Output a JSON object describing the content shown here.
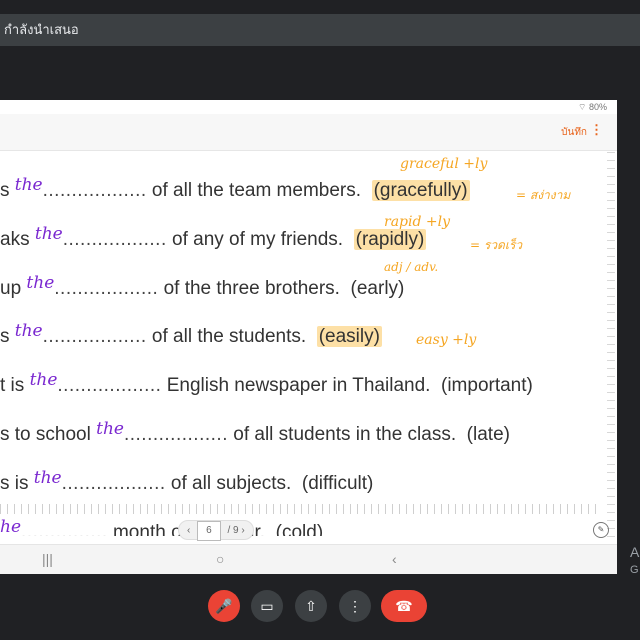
{
  "window": {
    "title": "กำลังนำเสนอ"
  },
  "device": {
    "battery": "80%"
  },
  "app": {
    "save_label": "บันทึก",
    "more_label": "⋮"
  },
  "sentences": [
    {
      "prefix": "s",
      "fill": "the",
      "dots": "..................",
      "rest": " of all the team members.",
      "hint": "(gracefully)",
      "hint_highlight": true
    },
    {
      "prefix": "aks",
      "fill": "the",
      "dots": "..................",
      "rest": " of any of my friends.",
      "hint": "(rapidly)",
      "hint_highlight": true
    },
    {
      "prefix": "up",
      "fill": "the",
      "dots": "..................",
      "rest": " of the three brothers.",
      "hint": "(early)",
      "hint_highlight": false
    },
    {
      "prefix": "s",
      "fill": "the",
      "dots": "..................",
      "rest": " of all the students.",
      "hint": "(easily)",
      "hint_highlight": true
    },
    {
      "prefix": "t is",
      "fill": "the",
      "dots": "..................",
      "rest": " English newspaper in Thailand.",
      "hint": "(important)",
      "hint_highlight": false
    },
    {
      "prefix": "s to school",
      "fill": "the",
      "dots": "..................",
      "rest": " of all students in the class.",
      "hint": "(late)",
      "hint_highlight": false
    },
    {
      "prefix": "s is",
      "fill": "the",
      "dots": "..................",
      "rest": " of all subjects.",
      "hint": "(difficult)",
      "hint_highlight": false
    },
    {
      "prefix": "",
      "fill": "he",
      "dots": "...............",
      "rest": " month of the year.",
      "hint": "(cold)",
      "hint_highlight": false
    }
  ],
  "notes": [
    {
      "text": "graceful +ly"
    },
    {
      "text": "= สง่างาม"
    },
    {
      "text": "rapid +ly"
    },
    {
      "text": "= รวดเร็ว"
    },
    {
      "text": "adj / adv."
    },
    {
      "text": "easy +ly"
    }
  ],
  "pager": {
    "current": "6",
    "total": "/ 9",
    "prev": "‹",
    "next": "›"
  },
  "nav": {
    "recent": "|||",
    "home": "○",
    "back": "‹"
  },
  "meet_controls": {
    "mic_off": "🎤",
    "camera": "▭",
    "present": "⇧",
    "more": "⋮",
    "hangup": "☎"
  },
  "side_text": {
    "line1": "A",
    "line2": "G"
  }
}
